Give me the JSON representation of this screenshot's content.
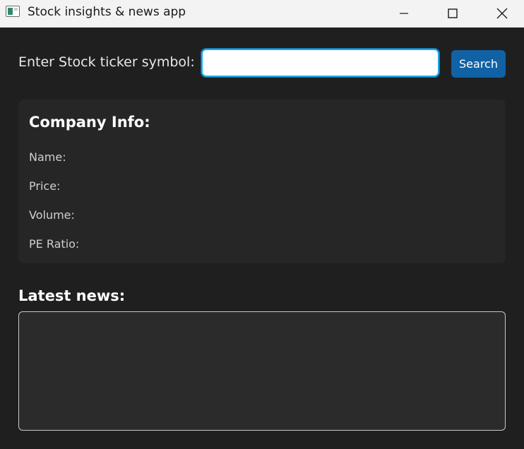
{
  "window": {
    "title": "Stock insights & news app",
    "icon": "app-window-icon"
  },
  "search": {
    "label": "Enter Stock ticker symbol:",
    "value": "",
    "placeholder": "",
    "button_label": "Search"
  },
  "company_info": {
    "title": "Company Info:",
    "fields": {
      "name_label": "Name:",
      "price_label": "Price:",
      "volume_label": "Volume:",
      "pe_label": "PE Ratio:"
    }
  },
  "news": {
    "title": "Latest news:",
    "content": ""
  },
  "colors": {
    "background": "#1f1f1f",
    "panel": "#262626",
    "accent_button": "#1062a5",
    "input_focus_border": "#1ea8e6"
  }
}
